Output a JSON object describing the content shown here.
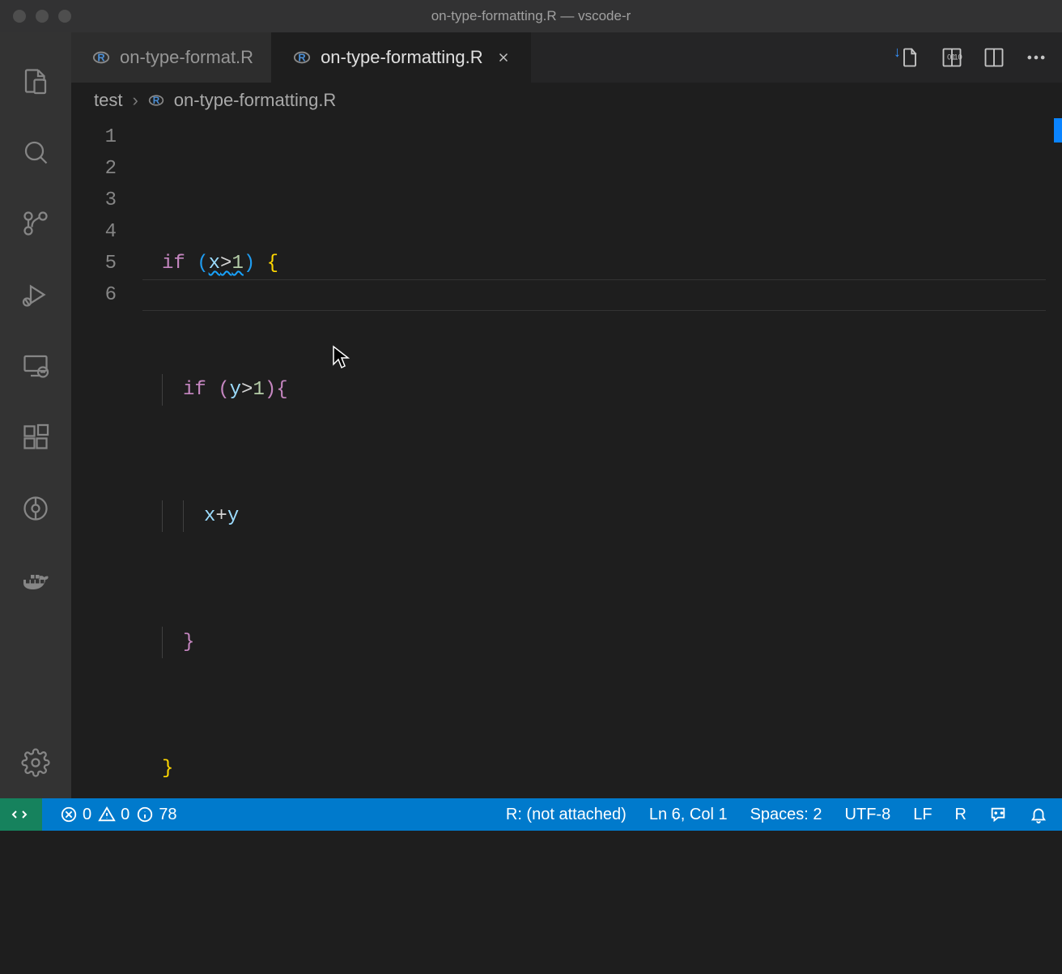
{
  "window": {
    "title": "on-type-formatting.R — vscode-r"
  },
  "tabs": {
    "items": [
      {
        "label": "on-type-format.R",
        "active": false
      },
      {
        "label": "on-type-formatting.R",
        "active": true
      }
    ]
  },
  "breadcrumb": {
    "parts": [
      "test",
      "on-type-formatting.R"
    ]
  },
  "gutter": [
    "1",
    "2",
    "3",
    "4",
    "5",
    "6"
  ],
  "code": {
    "tokens": {
      "if": "if",
      "x": "x",
      "y": "y",
      "gt": ">",
      "one": "1",
      "plus": "+",
      "lbrace": "{",
      "rbrace": "}",
      "lparen": "(",
      "rparen": ")"
    }
  },
  "status": {
    "errors": "0",
    "warnings": "0",
    "info": "78",
    "r_status": "R: (not attached)",
    "ln_col": "Ln 6, Col 1",
    "spaces": "Spaces: 2",
    "encoding": "UTF-8",
    "eol": "LF",
    "lang": "R"
  }
}
